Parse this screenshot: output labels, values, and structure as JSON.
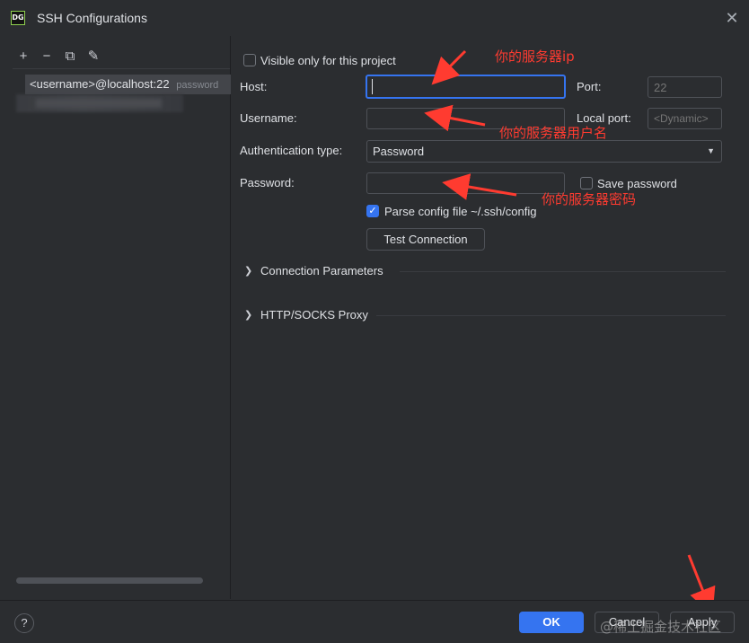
{
  "window": {
    "logo_text": "DG",
    "title": "SSH Configurations",
    "close_glyph": "✕"
  },
  "left_panel": {
    "toolbar": {
      "add_glyph": "+",
      "remove_glyph": "−",
      "copy_glyph": "⧉",
      "edit_glyph": "✎"
    },
    "items": [
      {
        "label": "<username>@localhost:22",
        "sublabel": "password"
      }
    ]
  },
  "form": {
    "visible_only_label": "Visible only for this project",
    "visible_only_checked": false,
    "host_label": "Host:",
    "host_value": "",
    "port_label": "Port:",
    "port_placeholder": "22",
    "username_label": "Username:",
    "username_value": "",
    "local_port_label": "Local port:",
    "local_port_placeholder": "<Dynamic>",
    "auth_type_label": "Authentication type:",
    "auth_type_value": "Password",
    "password_label": "Password:",
    "password_value": "",
    "save_password_label": "Save password",
    "save_password_checked": false,
    "parse_config_label": "Parse config file ~/.ssh/config",
    "parse_config_checked": true,
    "test_connection_label": "Test Connection",
    "sections": [
      {
        "label": "Connection Parameters"
      },
      {
        "label": "HTTP/SOCKS Proxy"
      }
    ]
  },
  "annotations": {
    "host_note": "你的服务器ip",
    "username_note": "你的服务器用户名",
    "password_note": "你的服务器密码",
    "color": "#ff3b30"
  },
  "footer": {
    "help_glyph": "?",
    "ok_label": "OK",
    "cancel_label": "Cancel",
    "apply_label": "Apply",
    "watermark": "@稀土掘金技术社区"
  },
  "colors": {
    "accent": "#3574f0",
    "background": "#2b2d30",
    "annotation": "#ff3b30"
  }
}
